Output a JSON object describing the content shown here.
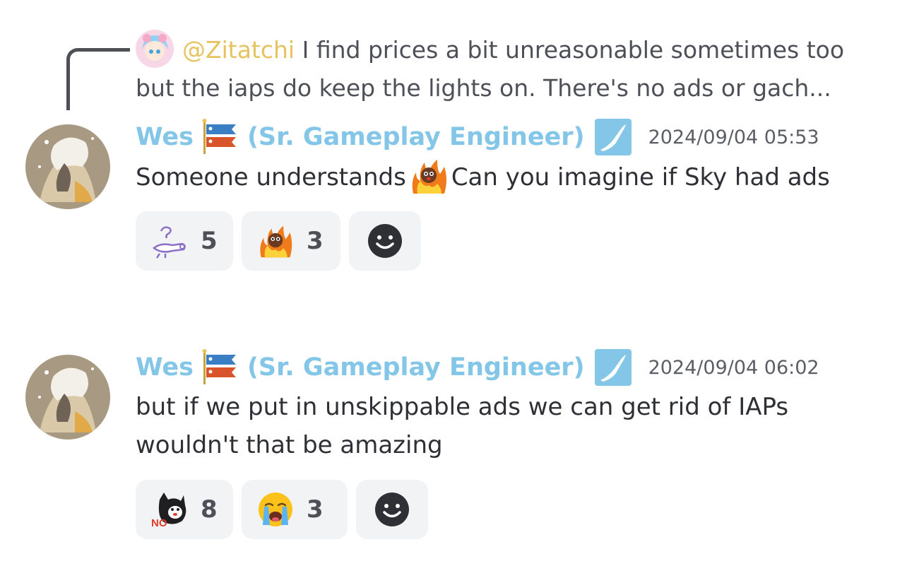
{
  "reply": {
    "author": "@Zitatchi",
    "text_line1": "I find prices a bit unreasonable sometimes too",
    "text_line2": "but the iaps do keep the lights on. There's no ads or gach..."
  },
  "messages": [
    {
      "username": "Wes",
      "role": "(Sr. Gameplay Engineer)",
      "timestamp": "2024/09/04 05:53",
      "text_before": "Someone understands",
      "text_after": "Can you imagine if Sky had ads",
      "reactions": [
        {
          "emoji": "ghost-sprite-emoji",
          "count": "5"
        },
        {
          "emoji": "fire-crab-emoji",
          "count": "3"
        }
      ]
    },
    {
      "username": "Wes",
      "role": "(Sr. Gameplay Engineer)",
      "timestamp": "2024/09/04 06:02",
      "text_line1": "but if we put in unskippable ads we can get rid of IAPs",
      "text_line2": "wouldn't that be amazing",
      "reactions": [
        {
          "emoji": "no-dog-emoji",
          "count": "8"
        },
        {
          "emoji": "loudly-crying-face-emoji",
          "count": "3"
        }
      ]
    }
  ],
  "colors": {
    "username": "#84c6e8",
    "reply_author": "#e6c35f",
    "reaction_bg": "#f2f3f5",
    "text": "#2e3035",
    "muted": "#4e5058"
  }
}
